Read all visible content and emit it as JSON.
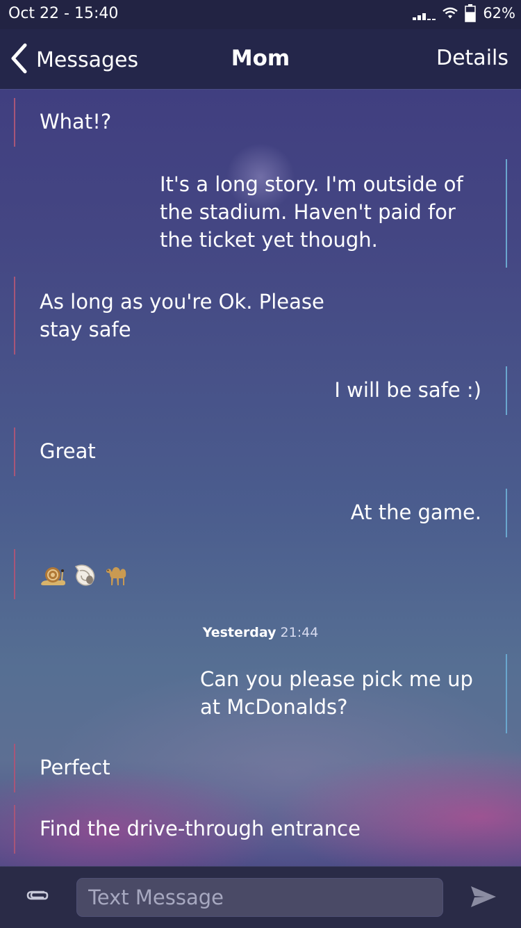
{
  "status_bar": {
    "time": "Oct 22 - 15:40",
    "battery_percent": "62%",
    "battery_level": 0.62,
    "signal_bars": 3
  },
  "nav": {
    "back_label": "Messages",
    "title": "Mom",
    "details_label": "Details"
  },
  "messages": [
    {
      "direction": "incoming",
      "text": "What!?"
    },
    {
      "direction": "outgoing",
      "text": "It's a long story. I'm outside of the stadium. Haven't paid for the ticket yet though."
    },
    {
      "direction": "incoming",
      "text": "As long as you're Ok. Please stay safe"
    },
    {
      "direction": "outgoing",
      "text": "I will be safe :)"
    },
    {
      "direction": "incoming",
      "text": "Great"
    },
    {
      "direction": "outgoing",
      "text": "At the game."
    },
    {
      "direction": "incoming",
      "emoji": [
        "snail-icon",
        "spiral-shell-icon",
        "camel-icon"
      ]
    },
    {
      "direction": "outgoing",
      "text": "Can you please pick me up at McDonalds?"
    },
    {
      "direction": "incoming",
      "text": "Perfect"
    },
    {
      "direction": "incoming",
      "text": "Find the drive-through entrance"
    }
  ],
  "timestamp": {
    "day": "Yesterday",
    "time": "21:44"
  },
  "composer": {
    "placeholder": "Text Message",
    "value": ""
  },
  "colors": {
    "incoming_bar": "#a85678",
    "outgoing_bar": "#6aa7cf",
    "header_bg": "#24264a",
    "composer_bg": "#2a2b47"
  }
}
